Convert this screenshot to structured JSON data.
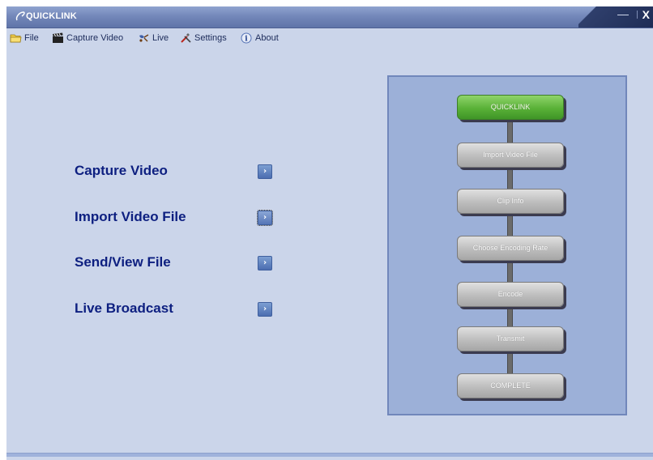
{
  "window": {
    "title": "QUICKLINK",
    "minimize_glyph": "—",
    "close_glyph": "X"
  },
  "menu": [
    {
      "label": "File",
      "icon": "folder-icon"
    },
    {
      "label": "Capture Video",
      "icon": "clapperboard-icon"
    },
    {
      "label": "Live",
      "icon": "satellite-icon"
    },
    {
      "label": "Settings",
      "icon": "tools-icon"
    },
    {
      "label": "About",
      "icon": "info-icon"
    }
  ],
  "options": [
    {
      "label": "Capture Video",
      "button": "›"
    },
    {
      "label": "Import Video File",
      "button": "›"
    },
    {
      "label": "Send/View File",
      "button": "›"
    },
    {
      "label": "Live Broadcast",
      "button": "›"
    }
  ],
  "workflow": {
    "steps": [
      {
        "label": "QUICKLINK",
        "state": "done"
      },
      {
        "label": "Import Video File",
        "state": "pending"
      },
      {
        "label": "Clip Info",
        "state": "pending"
      },
      {
        "label": "Choose Encoding Rate",
        "state": "pending"
      },
      {
        "label": "Encode",
        "state": "pending"
      },
      {
        "label": "Transmit",
        "state": "pending"
      },
      {
        "label": "COMPLETE",
        "state": "pending"
      }
    ]
  },
  "colors": {
    "background": "#cbd5ea",
    "option_text": "#0d1f80",
    "active_step": "#59b137",
    "pending_step": "#bdbdbd"
  }
}
